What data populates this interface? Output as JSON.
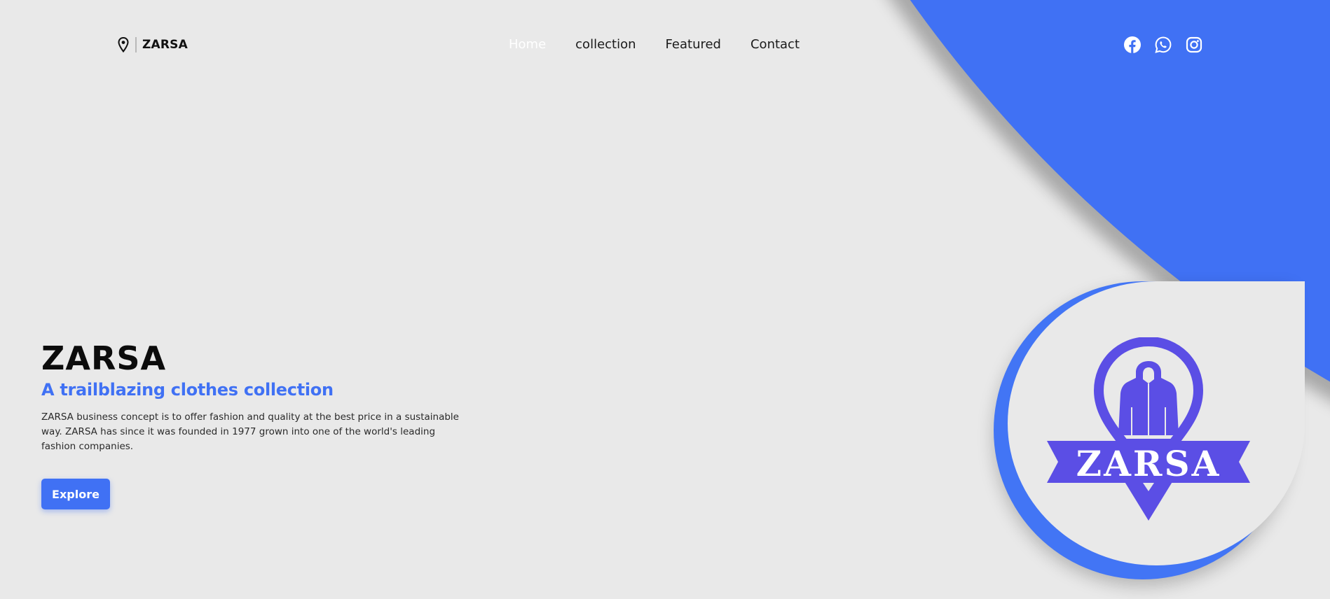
{
  "header": {
    "brand_name": "ZARSA",
    "brand_icon": "location-pin-icon",
    "nav": [
      {
        "label": "Home",
        "active": true
      },
      {
        "label": "collection",
        "active": false
      },
      {
        "label": "Featured",
        "active": false
      },
      {
        "label": "Contact",
        "active": false
      }
    ],
    "socials": [
      "facebook-icon",
      "whatsapp-icon",
      "instagram-icon"
    ]
  },
  "hero": {
    "title": "ZARSA",
    "subtitle": "A trailblazing clothes collection",
    "description": "ZARSA business concept is to offer fashion and quality at the best price in a sustainable way. ZARSA has since it was founded in 1977 grown into one of the world's leading fashion companies.",
    "cta_label": "Explore"
  },
  "logo": {
    "text": "ZARSA",
    "icon": "jacket-location-pin-logo"
  },
  "colors": {
    "accent": "#4071f4",
    "logo_purple": "#5b4ee5",
    "background": "#e9e9e9"
  }
}
